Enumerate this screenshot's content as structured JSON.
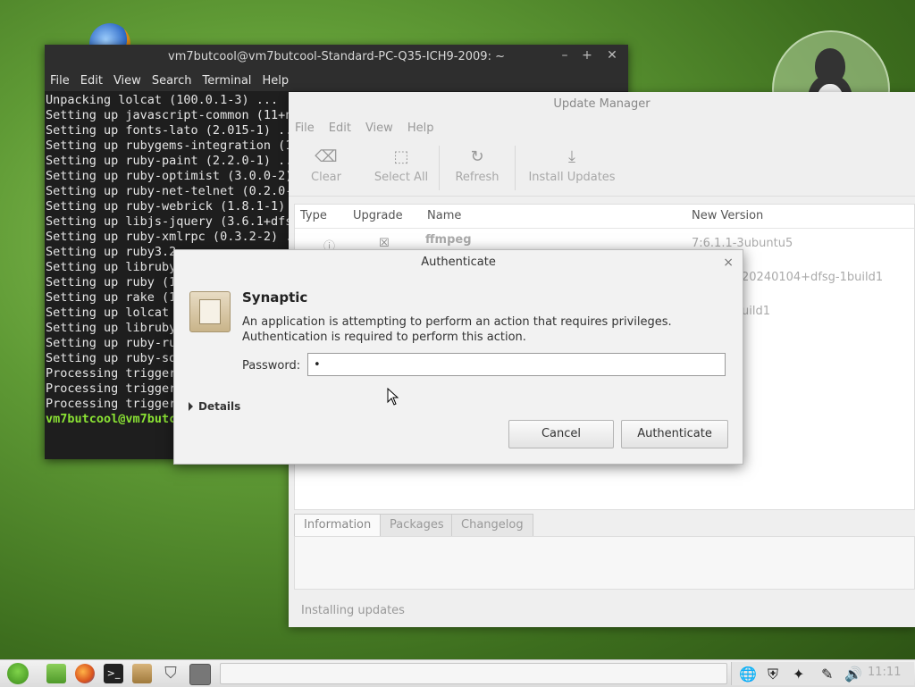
{
  "terminal": {
    "title": "vm7butcool@vm7butcool-Standard-PC-Q35-ICH9-2009: ~",
    "menu": [
      "File",
      "Edit",
      "View",
      "Search",
      "Terminal",
      "Help"
    ],
    "lines": [
      "Unpacking lolcat (100.0.1-3) ...",
      "Setting up javascript-common (11+n",
      "Setting up fonts-lato (2.015-1) ..",
      "Setting up rubygems-integration (1",
      "Setting up ruby-paint (2.2.0-1) ..",
      "Setting up ruby-optimist (3.0.0-2)",
      "Setting up ruby-net-telnet (0.2.0-",
      "Setting up ruby-webrick (1.8.1-1) ",
      "Setting up libjs-jquery (3.6.1+dfs",
      "Setting up ruby-xmlrpc (0.3.2-2) .",
      "Setting up ruby3.2",
      "Setting up libruby",
      "Setting up ruby (1",
      "Setting up rake (1",
      "Setting up lolcat ",
      "Setting up libruby",
      "Setting up ruby-ru",
      "Setting up ruby-sd",
      "Processing trigger",
      "Processing trigger",
      "Processing trigger"
    ],
    "prompt": "vm7butcool@vm7butco"
  },
  "update_manager": {
    "title": "Update Manager",
    "menu": [
      "File",
      "Edit",
      "View",
      "Help"
    ],
    "toolbar": {
      "clear": "Clear",
      "select_all": "Select All",
      "refresh": "Refresh",
      "install": "Install Updates"
    },
    "columns": {
      "type": "Type",
      "upgrade": "Upgrade",
      "name": "Name",
      "new_version": "New Version"
    },
    "rows": [
      {
        "name": "ffmpeg",
        "version": "7:6.1.1-3ubuntu5"
      },
      {
        "name": "",
        "version": "20240104+dfsg-1build1"
      },
      {
        "name": "",
        "version": "uild1"
      }
    ],
    "tabs": [
      "Information",
      "Packages",
      "Changelog"
    ],
    "status": "Installing updates"
  },
  "auth_dialog": {
    "title": "Authenticate",
    "close": "×",
    "app_name": "Synaptic",
    "message": "An application is attempting to perform an action that requires privileges. Authentication is required to perform this action.",
    "password_label": "Password:",
    "password_value": "•",
    "details_label": "Details",
    "cancel": "Cancel",
    "authenticate": "Authenticate"
  },
  "taskbar": {
    "clock": "11:11"
  },
  "colors": {
    "terminal_bg": "#1e1e1e",
    "prompt_green": "#8ae234",
    "desktop_green": "#5f9a35"
  }
}
